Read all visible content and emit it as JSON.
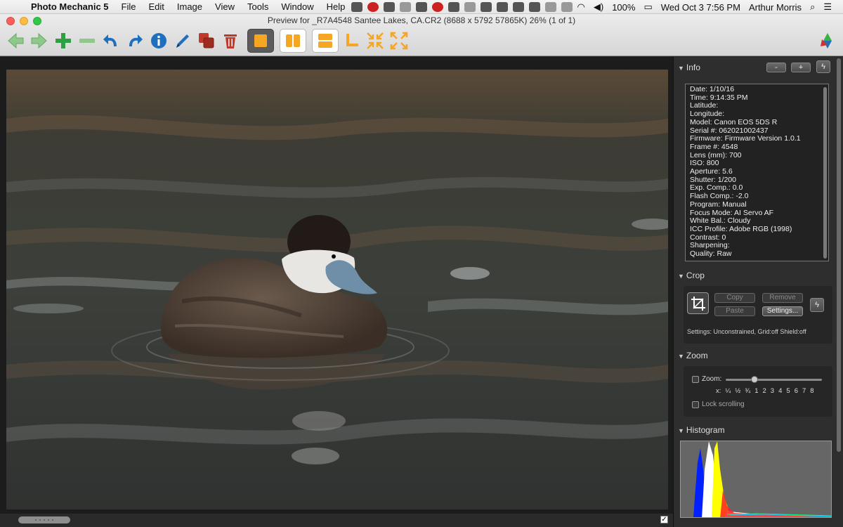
{
  "menubar": {
    "app_name": "Photo Mechanic 5",
    "menus": [
      "File",
      "Edit",
      "Image",
      "View",
      "Tools",
      "Window",
      "Help"
    ],
    "battery": "100%",
    "datetime": "Wed Oct 3  7:56 PM",
    "user": "Arthur Morris"
  },
  "window": {
    "title": "Preview for _R7A4548  Santee Lakes, CA.CR2 (8688 x 5792 57865K) 26% (1 of 1)"
  },
  "toolbar": {
    "icons": [
      "back-arrow-icon",
      "forward-arrow-icon",
      "add-icon",
      "remove-icon",
      "undo-rotate-icon",
      "redo-rotate-icon",
      "info-icon",
      "edit-pen-icon",
      "copy-stack-icon",
      "trash-icon",
      "single-view-icon",
      "side-by-side-icon",
      "stacked-view-icon",
      "crop-corner-icon",
      "shrink-arrows-icon",
      "expand-arrows-icon"
    ]
  },
  "info_panel": {
    "title": "Info",
    "minus_label": "-",
    "plus_label": "+",
    "lines": [
      "Date: 1/10/16",
      "Time: 9:14:35 PM",
      "Latitude:",
      "Longitude:",
      "Model: Canon EOS 5DS R",
      "Serial #: 062021002437",
      "Firmware: Firmware Version 1.0.1",
      "Frame #: 4548",
      "Lens (mm): 700",
      "ISO: 800",
      "Aperture: 5.6",
      "Shutter: 1/200",
      "Exp. Comp.: 0.0",
      "Flash Comp.: -2.0",
      "Program: Manual",
      "Focus Mode: AI Servo AF",
      "White Bal.: Cloudy",
      "ICC Profile: Adobe RGB (1998)",
      "Contrast: 0",
      "Sharpening:",
      "Quality: Raw"
    ]
  },
  "crop_panel": {
    "title": "Crop",
    "copy_label": "Copy",
    "remove_label": "Remove",
    "paste_label": "Paste",
    "settings_label": "Settings...",
    "settings_text": "Settings:  Unconstrained, Grid:off Shield:off"
  },
  "zoom_panel": {
    "title": "Zoom",
    "zoom_label": "Zoom:",
    "x_label": "x:",
    "ticks": [
      "¼",
      "½",
      "¾",
      "1",
      "2",
      "3",
      "4",
      "5",
      "6",
      "7",
      "8"
    ],
    "slider_value_fraction": 0.3,
    "lock_label": "Lock scrolling"
  },
  "histogram_panel": {
    "title": "Histogram"
  },
  "colors": {
    "accent_orange": "#f5a623",
    "toolbar_green": "#3cb043",
    "panel_bg": "#2e2e2e"
  }
}
